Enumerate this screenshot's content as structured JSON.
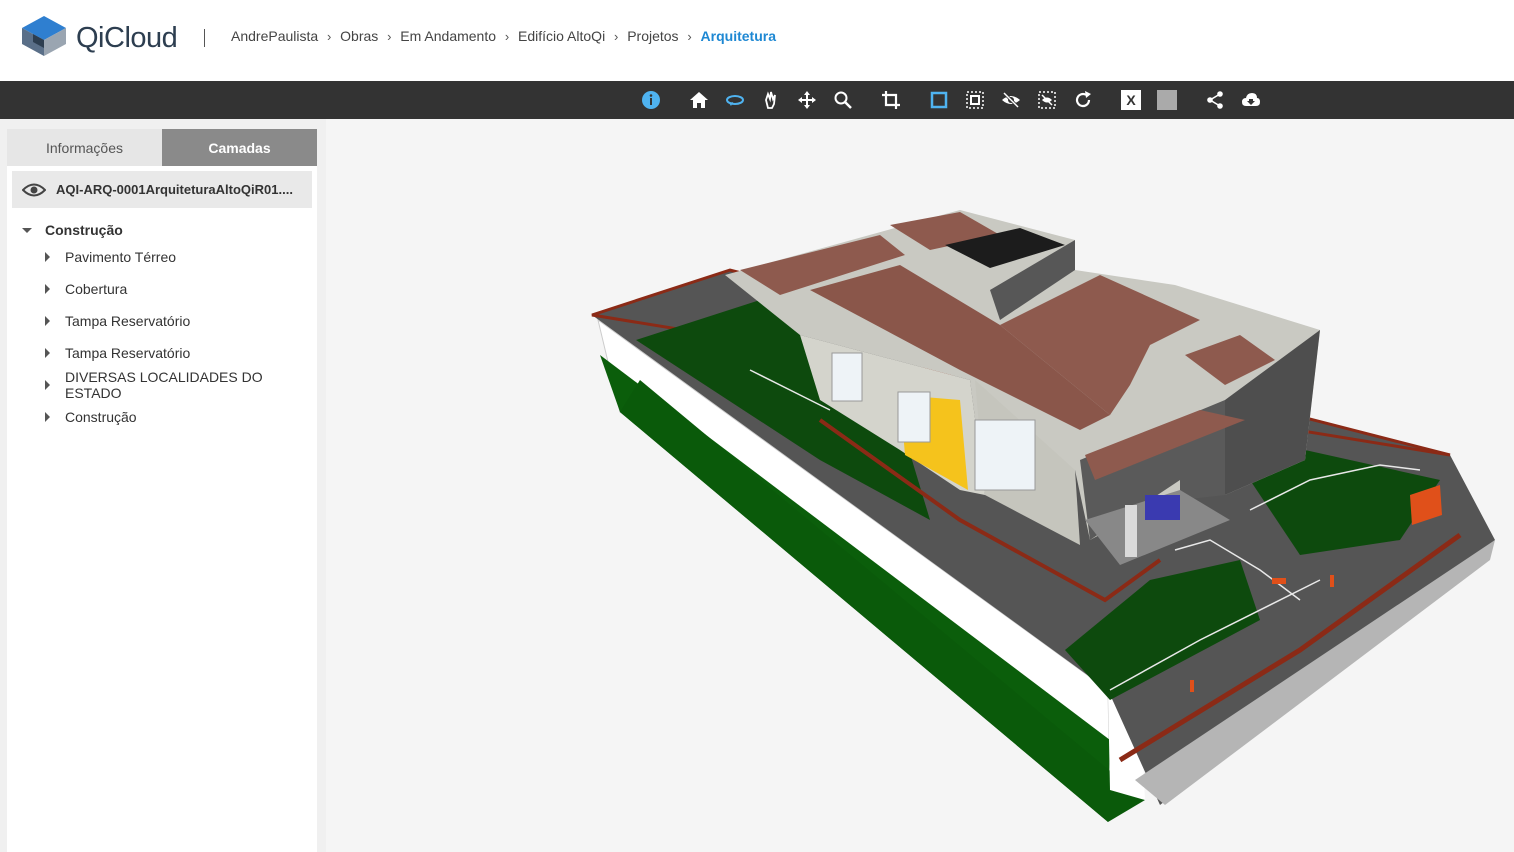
{
  "brand": {
    "name": "QiCloud"
  },
  "breadcrumb": [
    {
      "label": "AndrePaulista",
      "active": false
    },
    {
      "label": "Obras",
      "active": false
    },
    {
      "label": "Em Andamento",
      "active": false
    },
    {
      "label": "Edifício AltoQi",
      "active": false
    },
    {
      "label": "Projetos",
      "active": false
    },
    {
      "label": "Arquitetura",
      "active": true
    }
  ],
  "toolbar": {
    "icons": [
      "info-icon",
      "home-icon",
      "orbit-icon",
      "pan-hand-icon",
      "move-icon",
      "zoom-icon",
      "crop-icon",
      "select-box-icon",
      "select-area-icon",
      "hide-icon",
      "isolate-icon",
      "refresh-icon",
      "x-ray-icon",
      "gray-box-icon",
      "share-icon",
      "cloud-download-icon"
    ],
    "x_label": "X"
  },
  "sidebar": {
    "tabs": [
      {
        "label": "Informações",
        "active": false
      },
      {
        "label": "Camadas",
        "active": true
      }
    ],
    "model_name": "AQI-ARQ-0001ArquiteturaAltoQiR01....",
    "tree_root": "Construção",
    "tree_items": [
      "Pavimento Térreo",
      "Cobertura",
      "Tampa Reservatório",
      "Tampa Reservatório",
      "DIVERSAS LOCALIDADES DO ESTADO",
      "Construção"
    ]
  },
  "colors": {
    "accent": "#1e88d3",
    "toolbar_bg": "#333333",
    "tab_active": "#8a8a8a",
    "viewer_bg": "#f5f5f5"
  }
}
